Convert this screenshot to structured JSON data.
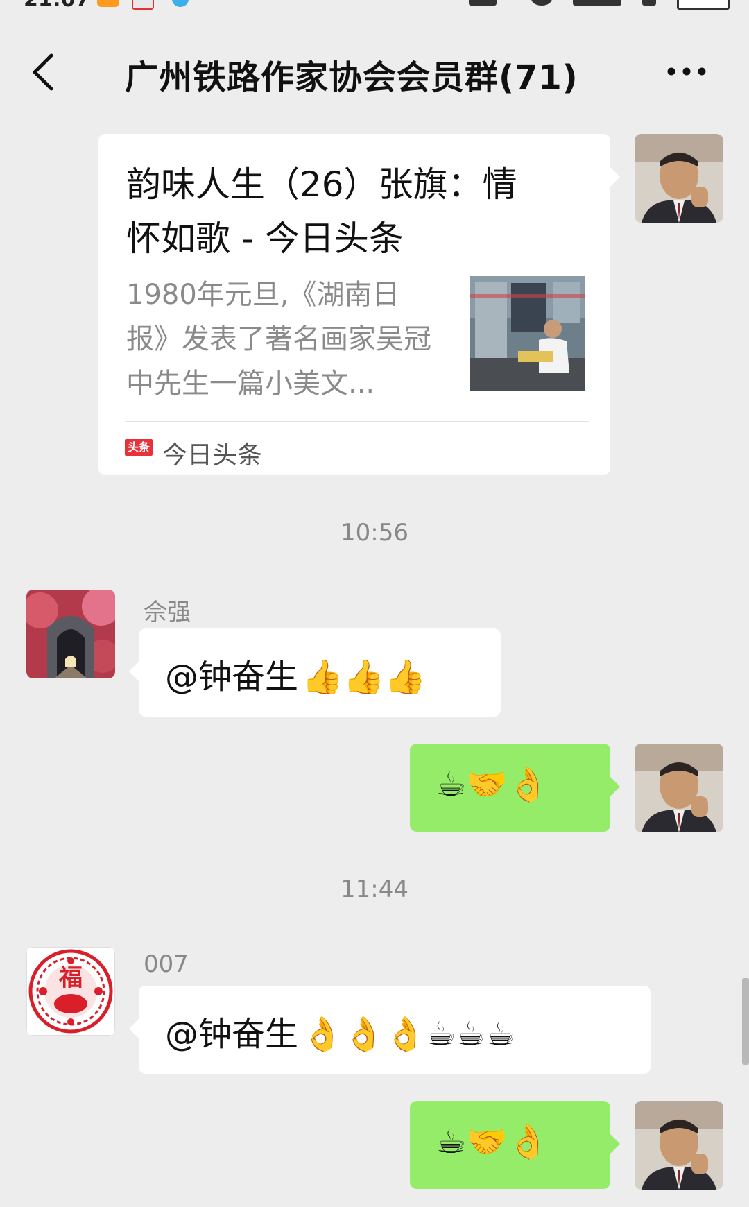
{
  "status_bar": {
    "time": "21:07"
  },
  "header": {
    "title": "广州铁路作家协会会员群(71)"
  },
  "messages": {
    "article": {
      "title": "韵味人生（26）张旗：情怀如歌 - 今日头条",
      "description": "1980年元旦,《湖南日报》发表了著名画家吴冠中先生一篇小美文...",
      "source_icon_text": "头条",
      "source": "今日头条"
    },
    "timestamp_1": "10:56",
    "msg_1": {
      "sender": "佘强",
      "mention": "@钟奋生",
      "emoji": "👍👍👍"
    },
    "msg_2": {
      "emoji": "☕🤝👌"
    },
    "timestamp_2": "11:44",
    "msg_3": {
      "sender": "007",
      "mention": "@钟奋生",
      "emoji": "👌👌👌☕☕☕"
    },
    "msg_4": {
      "emoji": "☕🤝👌"
    }
  },
  "colors": {
    "background": "#ededed",
    "bubble_self": "#95ec69",
    "bubble_other": "#ffffff"
  }
}
